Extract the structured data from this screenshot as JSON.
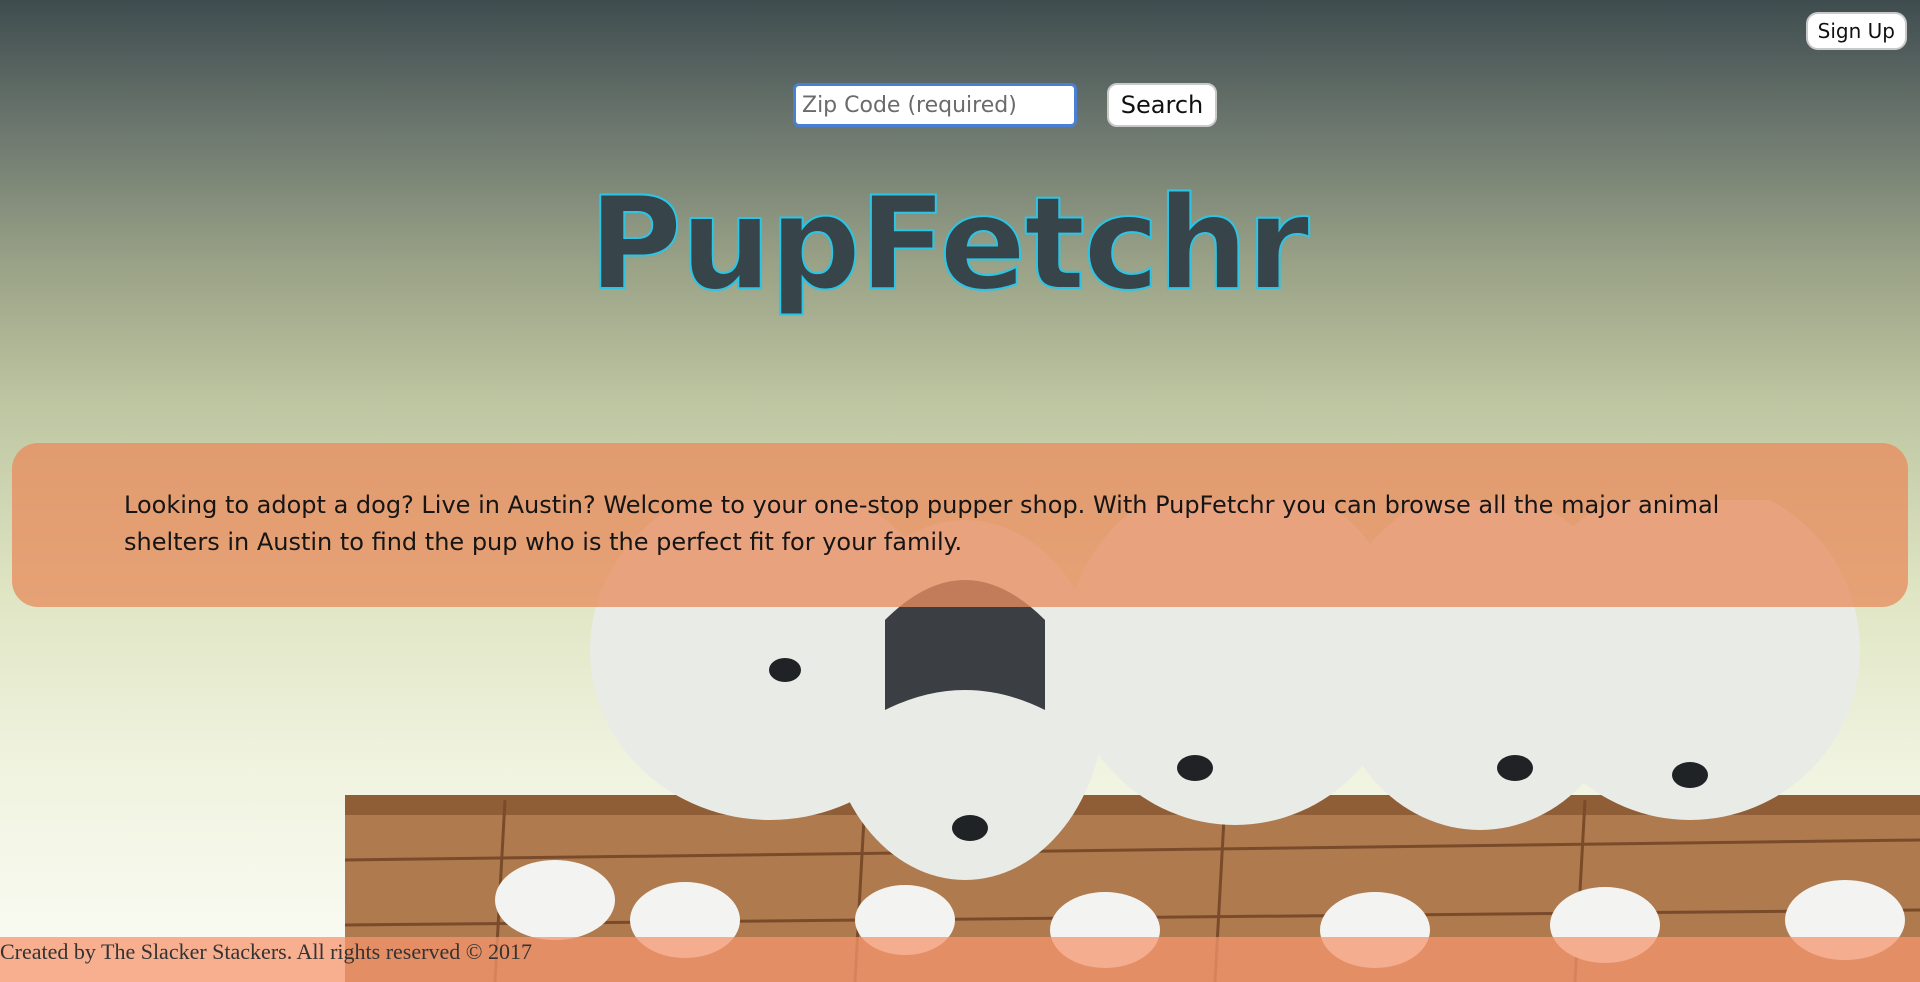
{
  "header": {
    "signup_label": "Sign Up"
  },
  "search": {
    "placeholder": "Zip Code (required)",
    "button_label": "Search"
  },
  "hero": {
    "logo_text": "PupFetchr"
  },
  "intro": {
    "text": "Looking to adopt a dog? Live in Austin? Welcome to your one-stop pupper shop. With PupFetchr you can browse all the major animal shelters in Austin to find the pup who is the perfect fit for your family."
  },
  "footer": {
    "text": "Created by The Slacker Stackers. All rights reserved © 2017"
  },
  "colors": {
    "accent": "#2ec4e4",
    "logo_fill": "#37454a",
    "panel": "#e88d5f"
  }
}
